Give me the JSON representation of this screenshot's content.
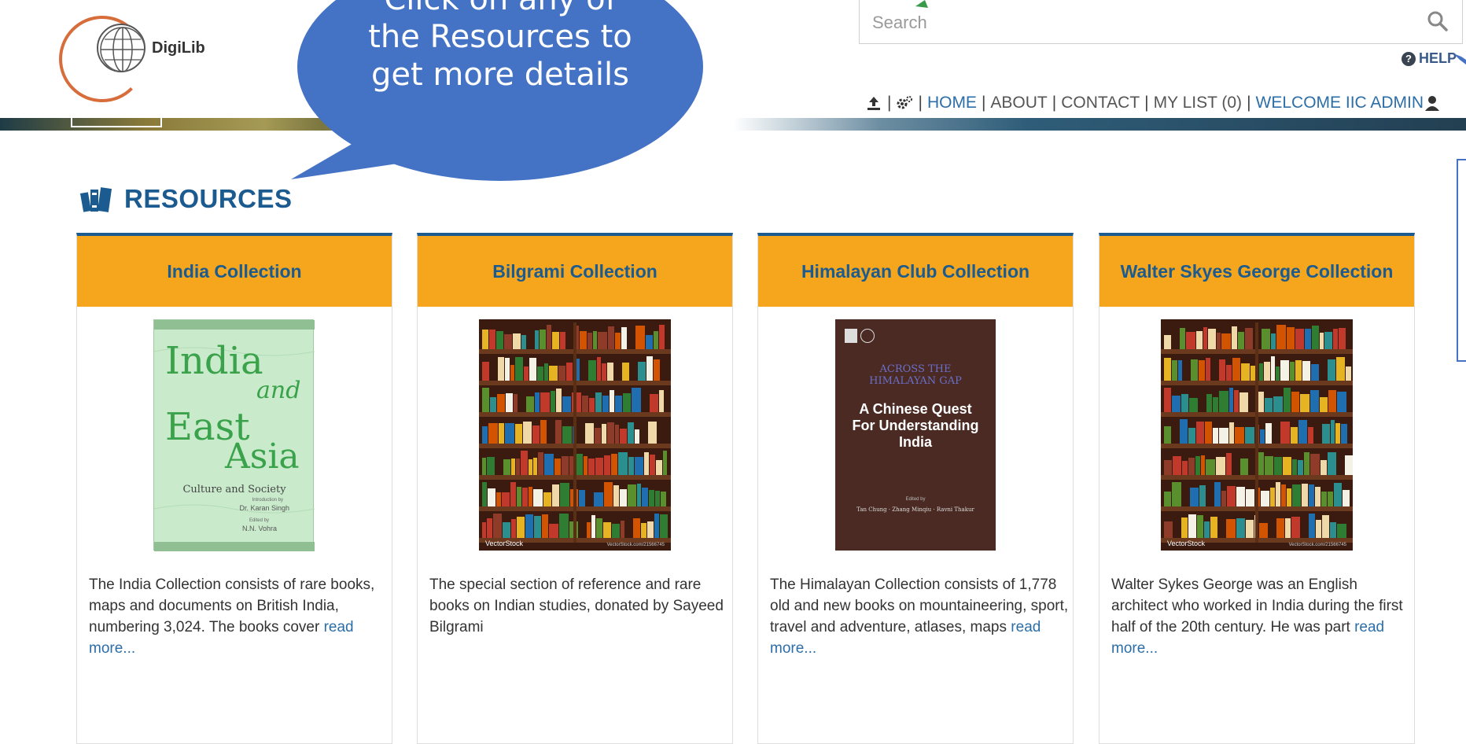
{
  "header": {
    "logo_text": "DigiLib",
    "search_placeholder": "Search",
    "help_label": "HELP",
    "nav": {
      "home": "HOME",
      "about": "ABOUT",
      "contact": "CONTACT",
      "my_list": "MY LIST (0)",
      "welcome": "WELCOME IIC ADMIN"
    },
    "icons": [
      "upload-icon",
      "settings-icon",
      "user-icon",
      "search-icon",
      "help-icon"
    ]
  },
  "callout": {
    "lines": [
      "Click on any of",
      "the Resources to",
      "get more details"
    ]
  },
  "resources": {
    "heading": "RESOURCES",
    "cards": [
      {
        "title": "India Collection",
        "desc": "The India Collection consists of rare books, maps and documents on British India, numbering 3,024. The books cover ",
        "read_more": "read more...",
        "cover": {
          "line1": "India",
          "line2": "and",
          "line3": "East",
          "line4": "Asia",
          "subtitle": "Culture and Society",
          "intro": "Introduction by",
          "author1": "Dr. Karan Singh",
          "edited": "Edited by",
          "author2": "N.N. Vohra"
        }
      },
      {
        "title": "Bilgrami Collection",
        "desc": "The special section of reference and rare books on Indian studies, donated by Sayeed Bilgrami",
        "read_more": "",
        "cover": {
          "brand": "VectorStock",
          "ref": "VectorStock.com/21566745"
        }
      },
      {
        "title": "Himalayan Club Collection",
        "desc": "The Himalayan Collection consists of 1,778 old and new books on mountaineering, sport, travel and adventure, atlases, maps ",
        "read_more": "read more...",
        "cover": {
          "top1": "ACROSS THE",
          "top2": "HIMALAYAN GAP",
          "main": "A Chinese Quest For Understanding India",
          "edited": "Edited by",
          "authors": "Tan Chung · Zhang Minqiu · Ravni Thakur"
        }
      },
      {
        "title": "Walter Skyes George Collection",
        "desc": "Walter Sykes George was an English architect who worked in India during the first half of the 20th century. He was part ",
        "read_more": "read more...",
        "cover": {
          "brand": "VectorStock",
          "ref": "VectorStock.com/21566745"
        }
      }
    ]
  },
  "colors": {
    "card_header": "#f5a61c",
    "title_blue": "#1b5b8f",
    "callout": "#4472c4",
    "link": "#2c6ea8"
  }
}
